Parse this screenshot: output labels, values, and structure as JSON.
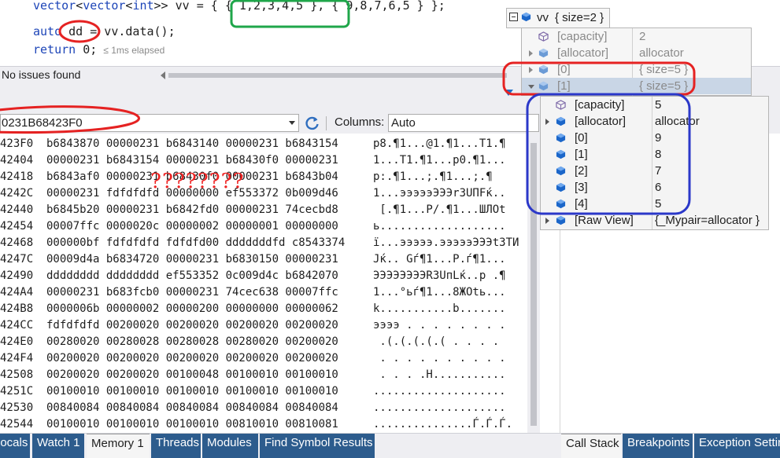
{
  "editor": {
    "line1": {
      "kw": "vector",
      "ty1": "vector",
      "ty2": "int",
      "rest": ">> vv = { ",
      "init1": "{ 1,2,3,4,5 }",
      "rest2": ", { 9,8,7,6,5 } };"
    },
    "line2": {
      "kw": "auto",
      "var": "dd",
      "rest": " = vv.data();"
    },
    "line3": {
      "kw": "return",
      "rest": " 0;",
      "hint": "≤ 1ms elapsed"
    }
  },
  "status": {
    "text": "No issues found"
  },
  "memory": {
    "address": "0231B68423F0",
    "columns_label": "Columns:",
    "columns_value": "Auto",
    "rows": [
      {
        "addr": "423F0",
        "hex": "b6843870 00000231 b6843140 00000231 b6843154",
        "ascii": "p8.¶1...@1.¶1...T1.¶"
      },
      {
        "addr": "42404",
        "hex": "00000231 b6843154 00000231 b68430f0 00000231",
        "ascii": "1...T1.¶1...p0.¶1..."
      },
      {
        "addr": "42418",
        "hex": "b6843af0 00000231 b68430f0 00000231 b6843b04",
        "ascii": "p:.¶1...;.¶1...;.¶"
      },
      {
        "addr": "4242C",
        "hex": "00000231 fdfdfdfd 00000000 ef553372 0b009d46",
        "ascii": "1...эээээЭЭЭr3UПFќ.."
      },
      {
        "addr": "42440",
        "hex": "b6845b20 00000231 b6842fd0 00000231 74cecbd8",
        "ascii": " [.¶1...Р/.¶1...ШЛОt"
      },
      {
        "addr": "42454",
        "hex": "00007ffc 0000020c 00000002 00000001 00000000",
        "ascii": "ь..................."
      },
      {
        "addr": "42468",
        "hex": "000000bf fdfdfdfd fdfdfd00 dddddddfd c8543374",
        "ascii": "ї...эээээ.эээээЭЭЭt3ТИ"
      },
      {
        "addr": "4247C",
        "hex": "00009d4a b6834720 00000231 b6830150 00000231",
        "ascii": "Jќ.. Gѓ¶1...P.ѓ¶1..."
      },
      {
        "addr": "42490",
        "hex": "dddddddd dddddddd ef553352 0c009d4c b6842070",
        "ascii": "ЭЭЭЭЭЭЭЭR3UпLќ..p .¶"
      },
      {
        "addr": "424A4",
        "hex": "00000231 b683fcb0 00000231 74cec638 00007ffc",
        "ascii": "1...°ьѓ¶1...8ЖОtь..."
      },
      {
        "addr": "424B8",
        "hex": "0000006b 00000002 00000200 00000000 00000062",
        "ascii": "k...........b......."
      },
      {
        "addr": "424CC",
        "hex": "fdfdfdfd 00200020 00200020 00200020 00200020",
        "ascii": "ээээ . . . . . . . ."
      },
      {
        "addr": "424E0",
        "hex": "00280020 00280028 00280028 00280020 00200020",
        "ascii": " .(.(.(.(.( . . . . "
      },
      {
        "addr": "424F4",
        "hex": "00200020 00200020 00200020 00200020 00200020",
        "ascii": " . . . . . . . . . ."
      },
      {
        "addr": "42508",
        "hex": "00200020 00200020 00100048 00100010 00100010",
        "ascii": " . . . .H..........."
      },
      {
        "addr": "4251C",
        "hex": "00100010 00100010 00100010 00100010 00100010",
        "ascii": "...................."
      },
      {
        "addr": "42530",
        "hex": "00840084 00840084 00840084 00840084 00840084",
        "ascii": "...................."
      },
      {
        "addr": "42544",
        "hex": "00100010 00100010 00100010 00810010 00810081",
        "ascii": "...............Ѓ.Ѓ.Ѓ."
      }
    ]
  },
  "annotation": {
    "question_marks": "????????"
  },
  "tooltip_vv": {
    "name": "vv",
    "value": "{ size=2 }",
    "rows": [
      {
        "name": "[capacity]",
        "value": "2"
      },
      {
        "name": "[allocator]",
        "value": "allocator"
      },
      {
        "name": "[0]",
        "value": "{ size=5 }"
      },
      {
        "name": "[1]",
        "value": "{ size=5 }"
      }
    ]
  },
  "tooltip_inner": {
    "rows": [
      {
        "name": "[capacity]",
        "value": "5"
      },
      {
        "name": "[allocator]",
        "value": "allocator"
      },
      {
        "name": "[0]",
        "value": "9"
      },
      {
        "name": "[1]",
        "value": "8"
      },
      {
        "name": "[2]",
        "value": "7"
      },
      {
        "name": "[3]",
        "value": "6"
      },
      {
        "name": "[4]",
        "value": "5"
      },
      {
        "name": "[Raw View]",
        "value": "{_Mypair=allocator }"
      }
    ]
  },
  "tabs_left": [
    "Locals",
    "Watch 1",
    "Memory 1",
    "Threads",
    "Modules",
    "Find Symbol Results"
  ],
  "tabs_right": [
    "Call Stack",
    "Breakpoints",
    "Exception Settings"
  ],
  "colors": {
    "annotation_green": "#1fa64a",
    "annotation_red": "#e52222",
    "annotation_blue": "#2b38c9",
    "tab_blue": "#2d5c8d"
  }
}
